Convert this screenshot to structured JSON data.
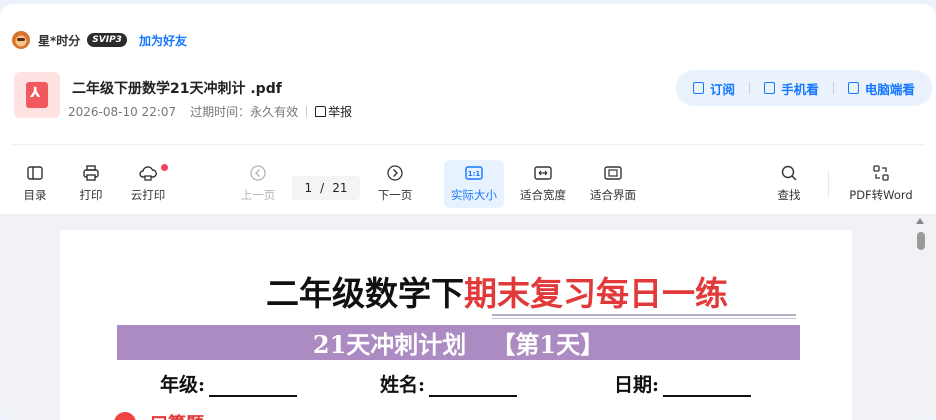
{
  "user": {
    "name": "星*时分",
    "badge": "SVIP3",
    "add_friend": "加为好友"
  },
  "file": {
    "title": "二年级下册数学21天冲刺计  .pdf",
    "date": "2026-08-10 22:07",
    "expire": "过期时间：永久有效",
    "report": "举报"
  },
  "actions": {
    "subscribe": "订阅",
    "mobile": "手机看",
    "desktop": "电脑端看"
  },
  "toolbar": {
    "catalog": "目录",
    "print": "打印",
    "cloud_print": "云打印",
    "prev": "上一页",
    "page_current": "1",
    "page_sep": "/",
    "page_total": "21",
    "next": "下一页",
    "actual_size": "实际大小",
    "fit_width": "适合宽度",
    "fit_page": "适合界面",
    "search": "查找",
    "to_word": "PDF转Word"
  },
  "document": {
    "title_black": "二年级数学下",
    "title_red": "期末复习每日一练",
    "plan": "21天冲刺计划   【第1天】",
    "grade_label": "年级:",
    "name_label": "姓名:",
    "date_label": "日期:",
    "section": "口算题"
  },
  "colors": {
    "accent": "#1677ff",
    "plan_bar": "#ac8bc2",
    "title_red": "#e23a3a"
  }
}
